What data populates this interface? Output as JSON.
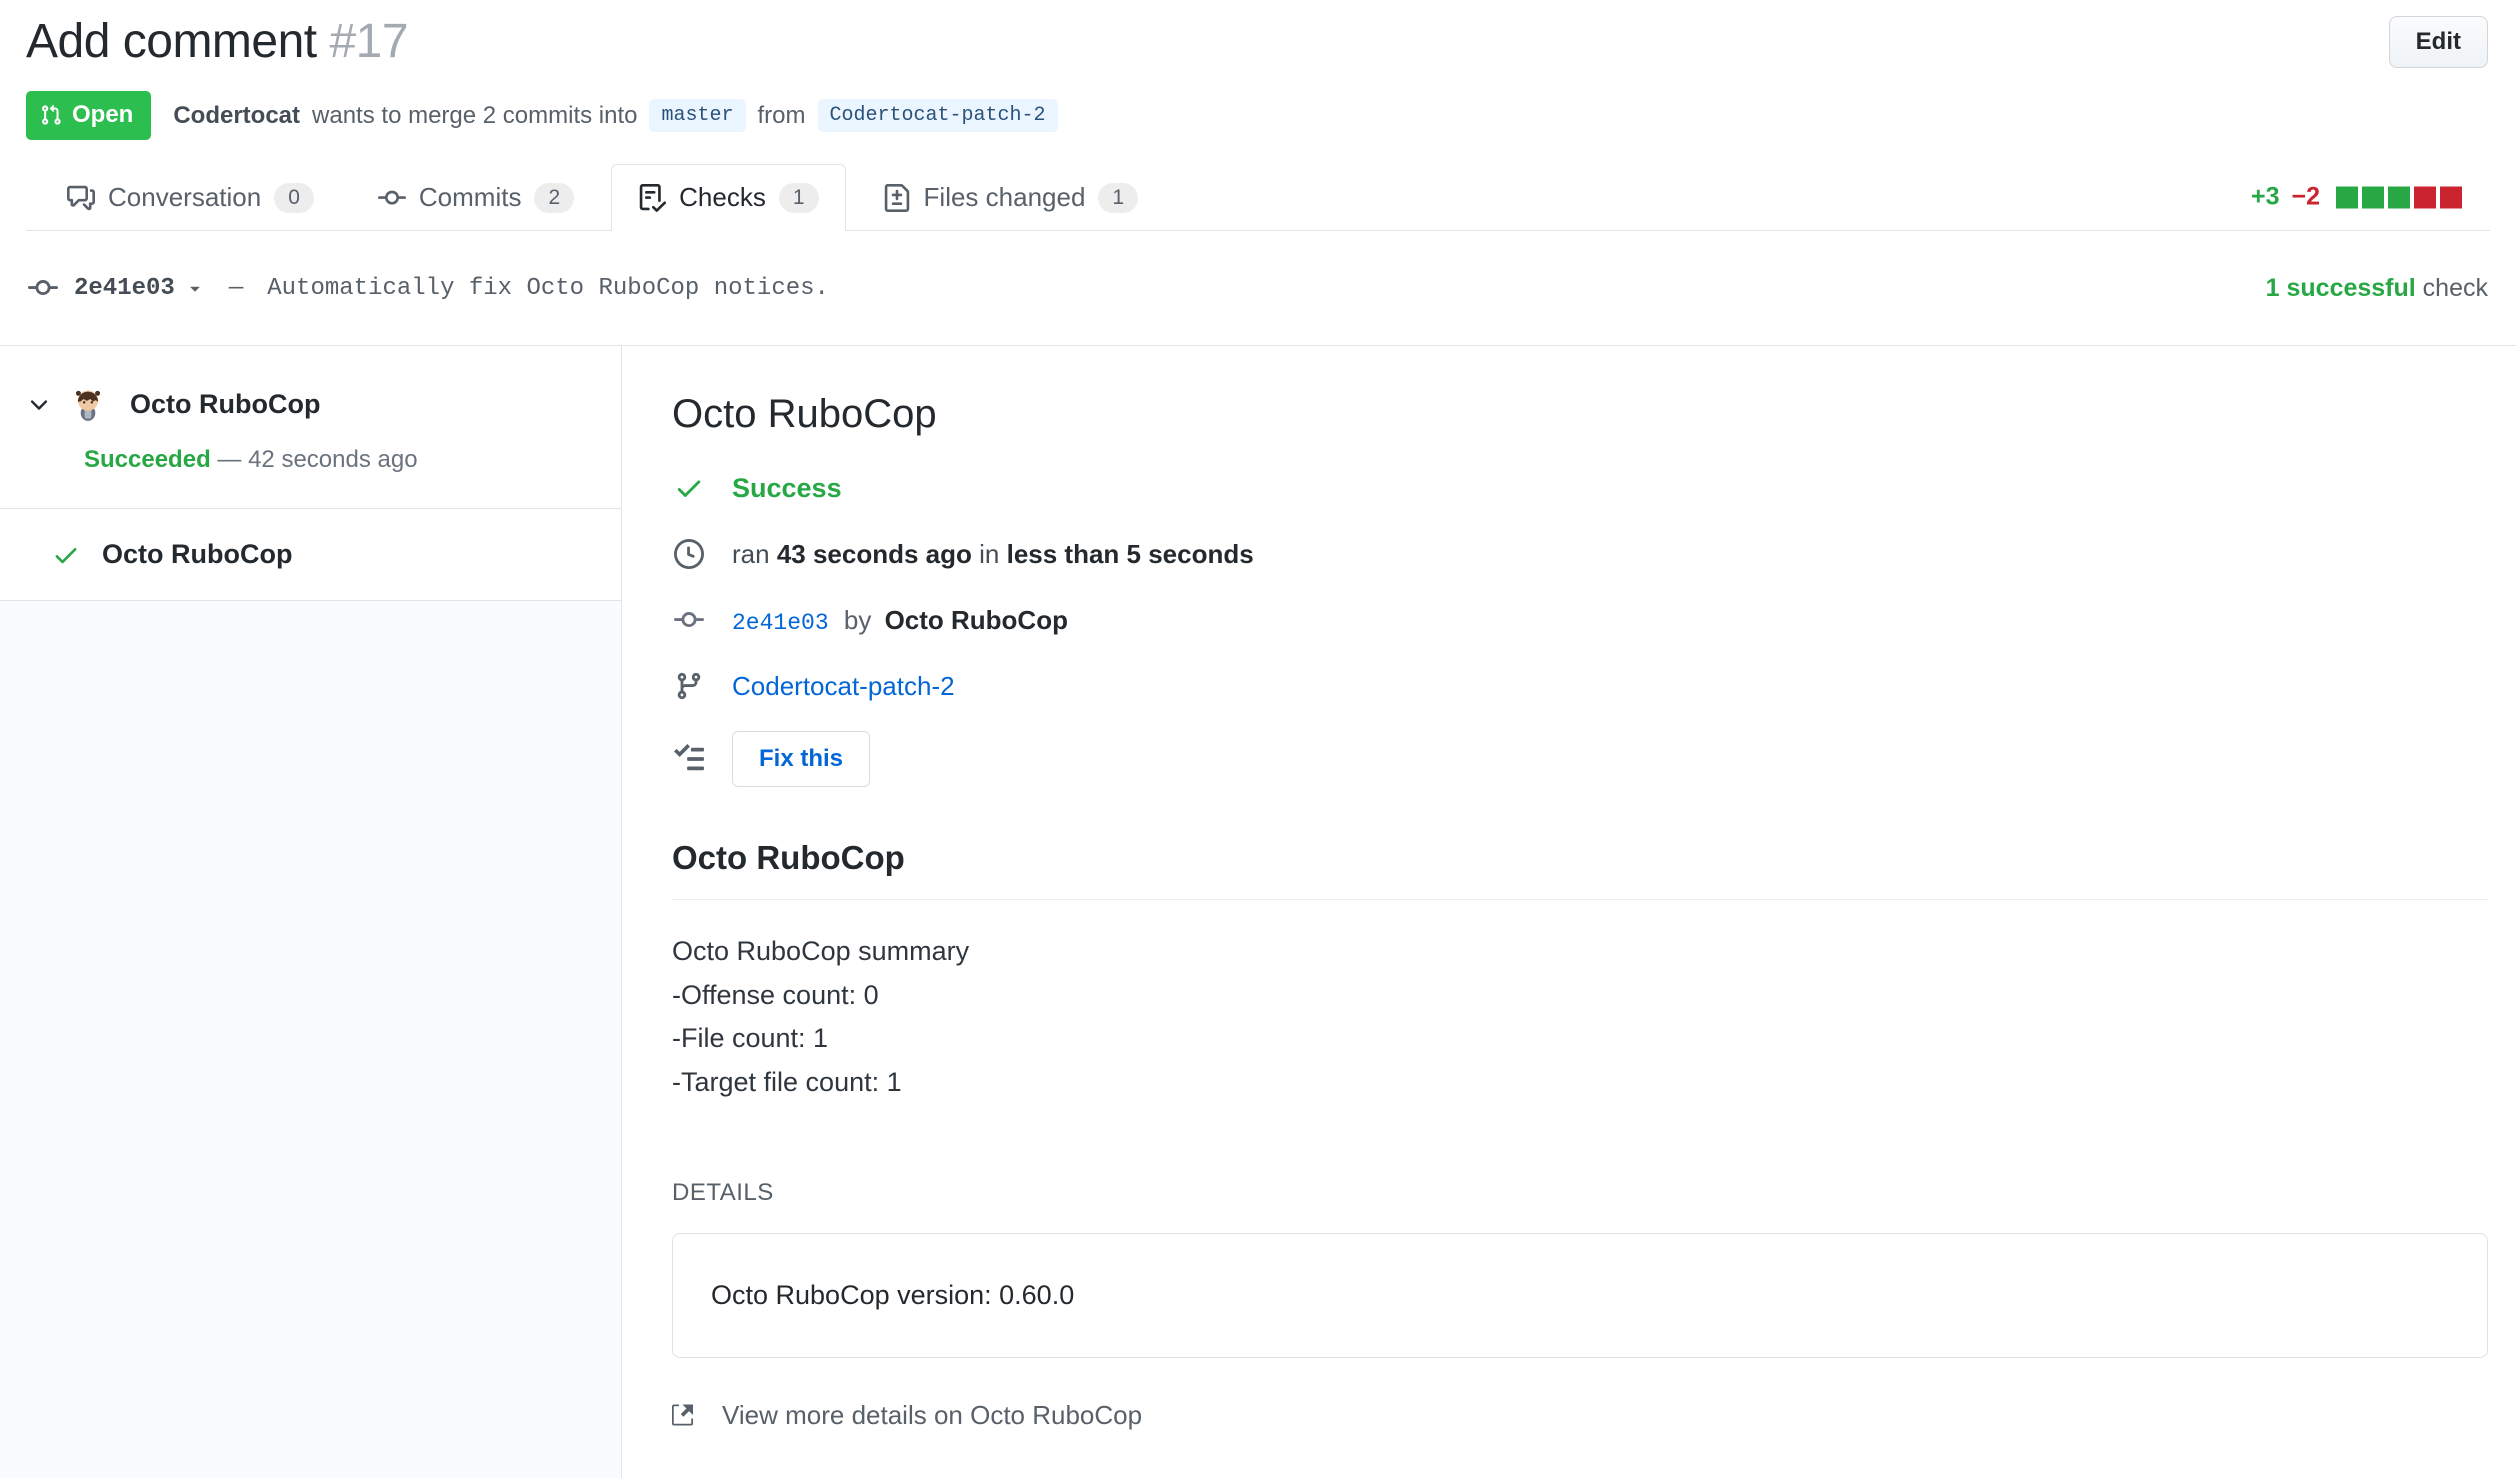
{
  "header": {
    "title": "Add comment",
    "number": "#17",
    "edit_button": "Edit",
    "status_badge": "Open",
    "merge_summary": {
      "author": "Codertocat",
      "middle": "wants to merge 2 commits into",
      "base_branch": "master",
      "from_word": "from",
      "head_branch": "Codertocat-patch-2"
    }
  },
  "tabs": [
    {
      "label": "Conversation",
      "count": "0",
      "active": false
    },
    {
      "label": "Commits",
      "count": "2",
      "active": false
    },
    {
      "label": "Checks",
      "count": "1",
      "active": true
    },
    {
      "label": "Files changed",
      "count": "1",
      "active": false
    }
  ],
  "diffstat": {
    "additions": "+3",
    "deletions": "−2",
    "blocks": [
      "added",
      "added",
      "added",
      "deleted",
      "deleted"
    ]
  },
  "commit_bar": {
    "sha": "2e41e03",
    "separator": "—",
    "message": "Automatically fix Octo RuboCop notices.",
    "status_strong": "1 successful",
    "status_rest": " check"
  },
  "sidebar": {
    "suite_name": "Octo RuboCop",
    "status_label": "Succeeded",
    "status_time": "— 42 seconds ago",
    "run_name": "Octo RuboCop"
  },
  "main": {
    "run_title": "Octo RuboCop",
    "status": "Success",
    "timing": {
      "prefix": "ran",
      "ago": "43 seconds ago",
      "infix": "in",
      "duration": "less than 5 seconds"
    },
    "commit": {
      "sha": "2e41e03",
      "by": "by",
      "author": "Octo RuboCop"
    },
    "branch": "Codertocat-patch-2",
    "fix_button": "Fix this",
    "section_title": "Octo RuboCop",
    "summary_lines": [
      "Octo RuboCop summary",
      "-Offense count: 0",
      "-File count: 1",
      "-Target file count: 1"
    ],
    "details_label": "DETAILS",
    "details_text": "Octo RuboCop version: 0.60.0",
    "footer_link": "View more details on Octo RuboCop"
  },
  "colors": {
    "open_badge_green": "#2cbe4e",
    "success_green": "#28a745",
    "deletion_red": "#cb2431",
    "link_blue": "#0366d6",
    "branch_ref_bg": "#eaf5ff"
  }
}
